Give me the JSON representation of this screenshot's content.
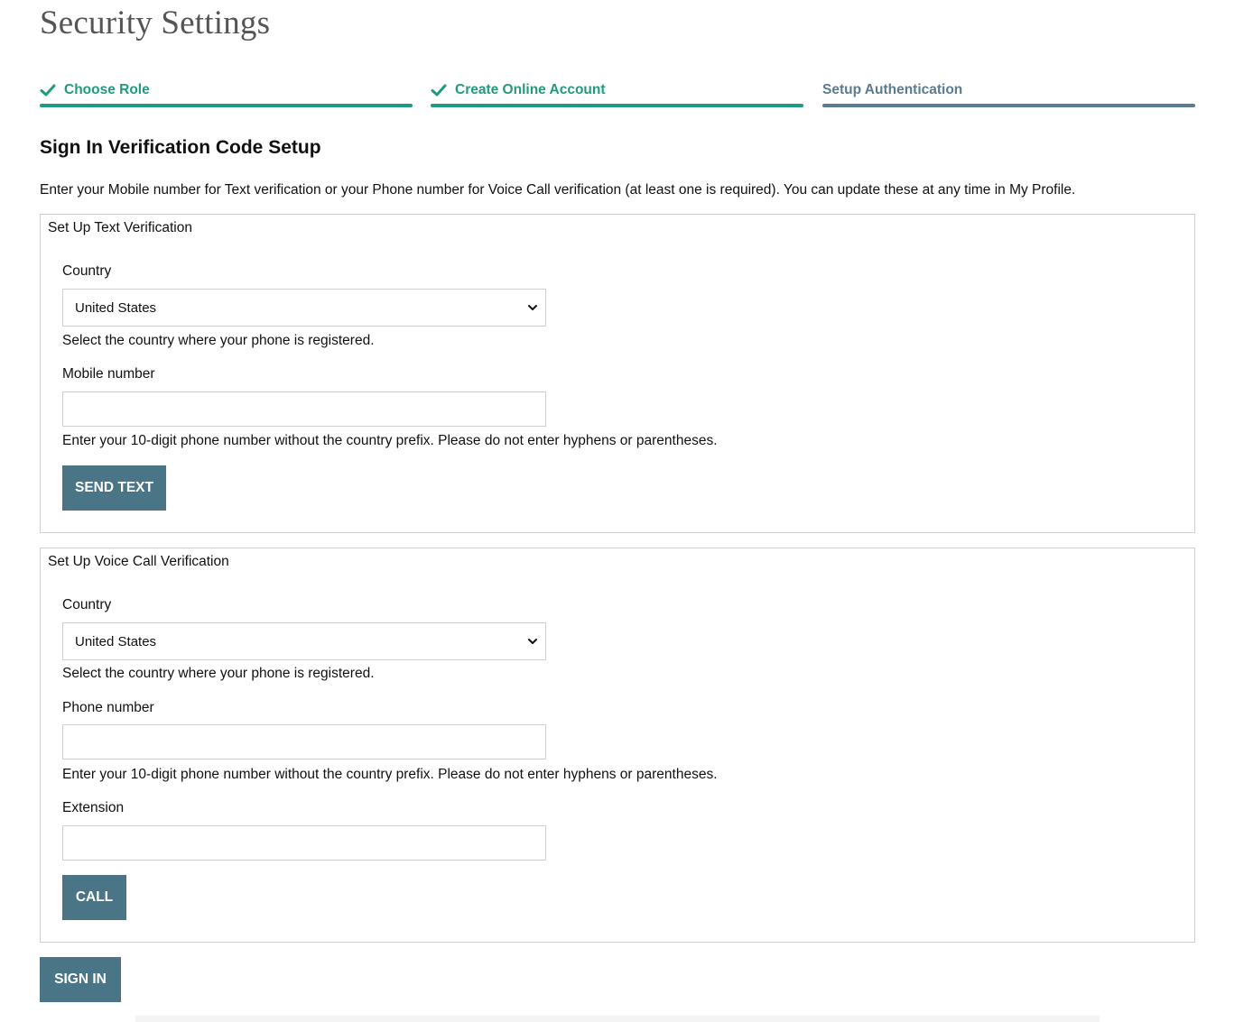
{
  "page": {
    "title": "Security Settings"
  },
  "steps": [
    {
      "label": "Choose Role",
      "status": "complete",
      "icon": "check-icon"
    },
    {
      "label": "Create Online Account",
      "status": "complete",
      "icon": "check-icon"
    },
    {
      "label": "Setup Authentication",
      "status": "current"
    }
  ],
  "section": {
    "heading": "Sign In Verification Code Setup",
    "intro": "Enter your Mobile number for Text verification or your Phone number for Voice Call verification (at least one is required). You can update these at any time in My Profile."
  },
  "text_verification": {
    "legend": "Set Up Text Verification",
    "country_label": "Country",
    "country_value": "United States",
    "country_help": "Select the country where your phone is registered.",
    "mobile_label": "Mobile number",
    "mobile_value": "",
    "mobile_help": "Enter your 10-digit phone number without the country prefix. Please do not enter hyphens or parentheses.",
    "button_label": "SEND TEXT"
  },
  "voice_verification": {
    "legend": "Set Up Voice Call Verification",
    "country_label": "Country",
    "country_value": "United States",
    "country_help": "Select the country where your phone is registered.",
    "phone_label": "Phone number",
    "phone_value": "",
    "phone_help": "Enter your 10-digit phone number without the country prefix. Please do not enter hyphens or parentheses.",
    "extension_label": "Extension",
    "extension_value": "",
    "button_label": "CALL"
  },
  "actions": {
    "sign_in_label": "SIGN IN"
  },
  "colors": {
    "complete": "#1f9b7f",
    "current": "#5b7b91",
    "button": "#497587",
    "title": "#555555"
  }
}
